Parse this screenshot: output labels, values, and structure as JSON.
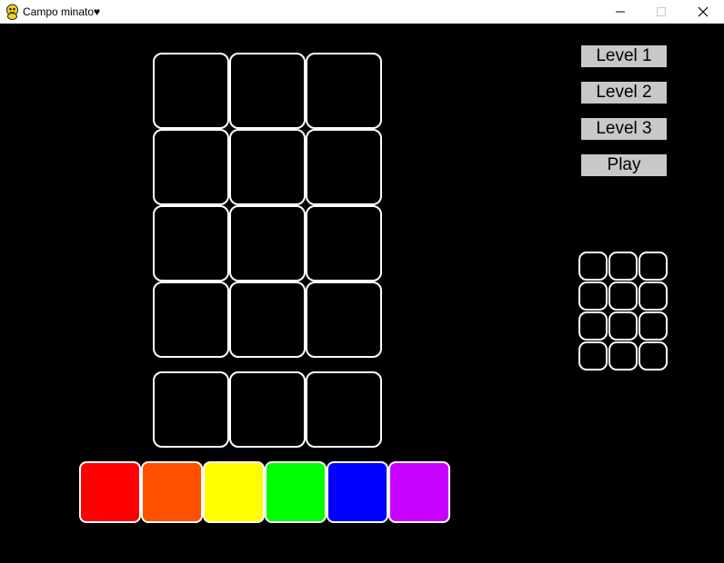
{
  "window": {
    "title": "Campo minato♥",
    "icon": "pygame-snake-icon",
    "controls": [
      "minimize",
      "maximize",
      "close"
    ]
  },
  "menu": {
    "level1": "Level 1",
    "level2": "Level 2",
    "level3": "Level 3",
    "play": "Play",
    "button_color": "#c8c8c8"
  },
  "board": {
    "guess_rows": 4,
    "columns": 3,
    "answer_row_slots": 3,
    "cell_border_color": "#ffffff"
  },
  "mini_grid": {
    "rows": 4,
    "columns": 3
  },
  "palette": [
    {
      "name": "red",
      "color": "#ff0000"
    },
    {
      "name": "orange",
      "color": "#ff5000"
    },
    {
      "name": "yellow",
      "color": "#ffff00"
    },
    {
      "name": "green",
      "color": "#00ff00"
    },
    {
      "name": "blue",
      "color": "#0000ff"
    },
    {
      "name": "purple",
      "color": "#c800ff"
    }
  ]
}
